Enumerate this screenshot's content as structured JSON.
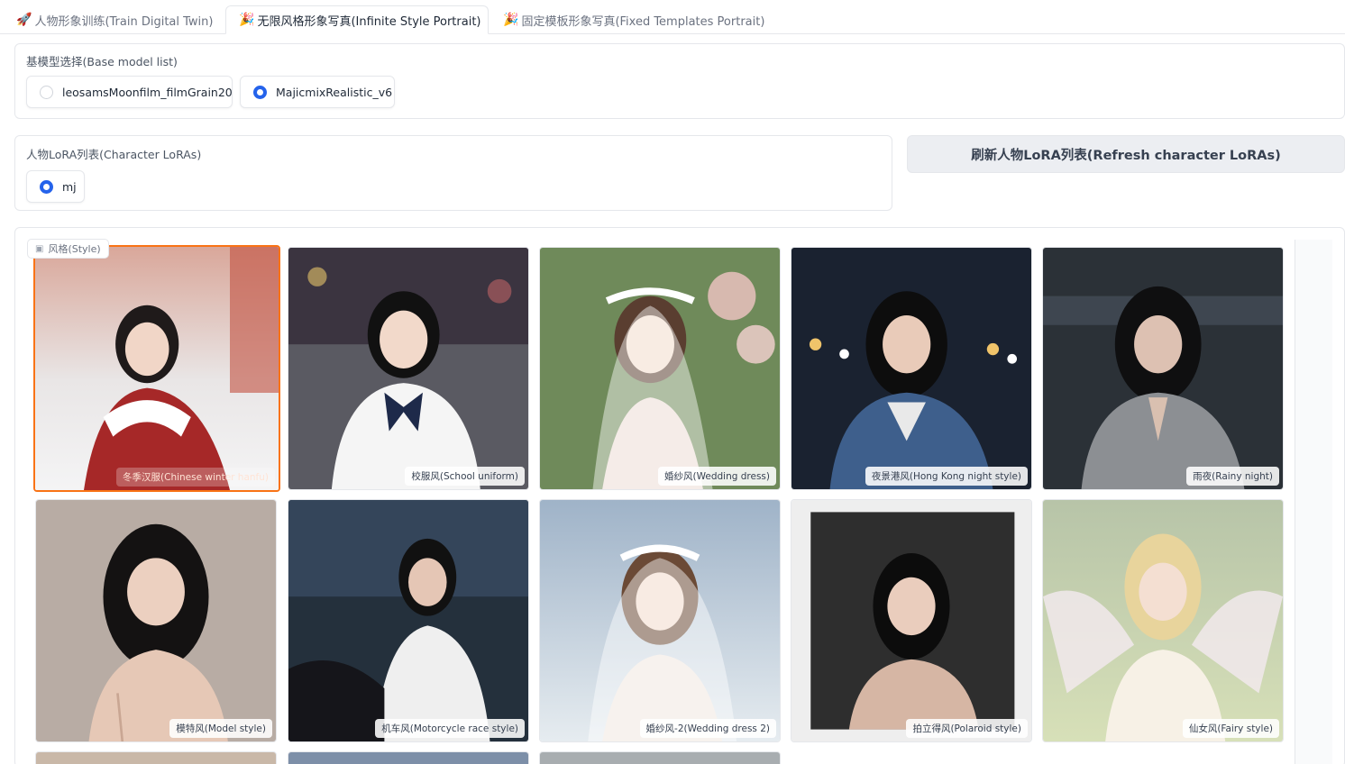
{
  "tabs": [
    {
      "icon": "🚀",
      "label": "人物形象训练(Train Digital Twin)",
      "active": false
    },
    {
      "icon": "🎉",
      "label": "无限风格形象写真(Infinite Style Portrait)",
      "active": true
    },
    {
      "icon": "🎉",
      "label": "固定模板形象写真(Fixed Templates Portrait)",
      "active": false
    }
  ],
  "base_model": {
    "label": "基模型选择(Base model list)",
    "options": [
      "leosamsMoonfilm_filmGrain20",
      "MajicmixRealistic_v6"
    ],
    "selected": "MajicmixRealistic_v6"
  },
  "character_lora": {
    "label": "人物LoRA列表(Character LoRAs)",
    "options": [
      "mj"
    ],
    "selected": "mj"
  },
  "refresh_button": "刷新人物LoRA列表(Refresh character LoRAs)",
  "gallery": {
    "label": "风格(Style)",
    "items": [
      "冬季汉服(Chinese winter hanfu)",
      "校服风(School uniform)",
      "婚纱风(Wedding dress)",
      "夜景港风(Hong Kong night style)",
      "雨夜(Rainy night)",
      "模特风(Model style)",
      "机车风(Motorcycle race style)",
      "婚纱风-2(Wedding dress 2)",
      "拍立得风(Polaroid style)",
      "仙女风(Fairy style)"
    ],
    "selected_index": 0
  },
  "colors": {
    "accent": "#2563eb",
    "selected_border": "#f97316",
    "button_bg": "#eceef2"
  }
}
